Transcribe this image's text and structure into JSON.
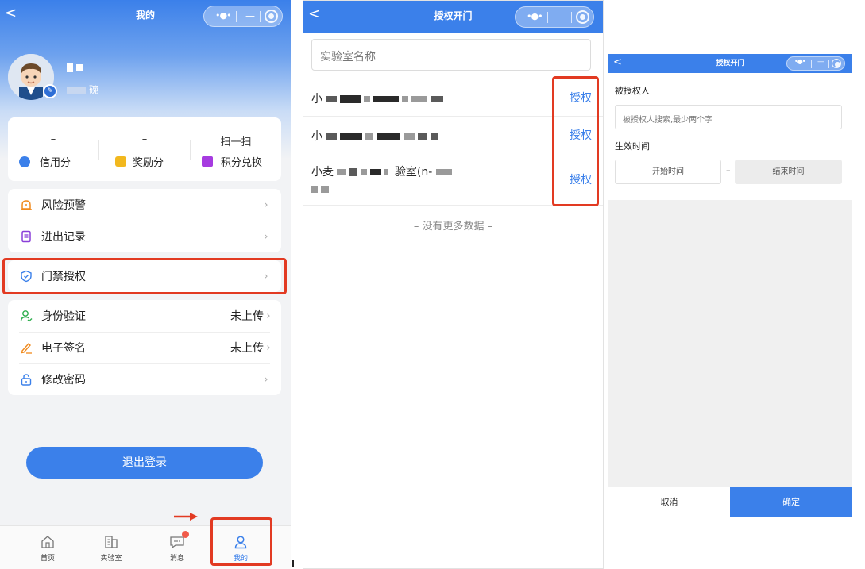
{
  "left": {
    "nav": {
      "title": "我的",
      "back": "<"
    },
    "profile": {
      "name_suffix": "碗"
    },
    "stats": [
      {
        "value": "–",
        "label": "信用分",
        "icon": "shield-user-icon"
      },
      {
        "value": "–",
        "label": "奖励分",
        "icon": "coins-icon"
      },
      {
        "value": "扫一扫",
        "label": "积分兑换",
        "icon": "gift-icon"
      }
    ],
    "menu_group1": [
      {
        "label": "风险预警",
        "icon": "alarm-icon"
      },
      {
        "label": "进出记录",
        "icon": "document-icon"
      }
    ],
    "access": {
      "label": "门禁授权",
      "icon": "shield-check-icon"
    },
    "menu_group2": [
      {
        "label": "身份验证",
        "value": "未上传",
        "icon": "user-verify-icon"
      },
      {
        "label": "电子签名",
        "value": "未上传",
        "icon": "pen-icon"
      },
      {
        "label": "修改密码",
        "value": "",
        "icon": "lock-icon"
      }
    ],
    "logout": "退出登录",
    "tabs": [
      {
        "label": "首页",
        "icon": "home-icon"
      },
      {
        "label": "实验室",
        "icon": "building-icon"
      },
      {
        "label": "消息",
        "icon": "message-icon"
      },
      {
        "label": "我的",
        "icon": "user-icon"
      }
    ]
  },
  "middle": {
    "nav": {
      "title": "授权开门",
      "back": "<"
    },
    "search": {
      "placeholder": "实验室名称"
    },
    "items": [
      {
        "prefix": "小",
        "action": "授权"
      },
      {
        "prefix": "小",
        "action": "授权"
      },
      {
        "prefix": "小麦",
        "mid": "验室(n-",
        "line2": "",
        "action": "授权"
      }
    ],
    "no_more": "– 没有更多数据 –"
  },
  "right": {
    "nav": {
      "title": "授权开门",
      "back": "<"
    },
    "grantee_label": "被授权人",
    "grantee_placeholder": "被授权人搜索,最少两个字",
    "time_label": "生效时间",
    "start_time": "开始时间",
    "dash": "–",
    "end_time": "结束时间",
    "cancel": "取消",
    "confirm": "确定"
  },
  "colors": {
    "brand": "#3b80ea",
    "highlight": "#e23a22",
    "badge": "#f05a4a"
  }
}
